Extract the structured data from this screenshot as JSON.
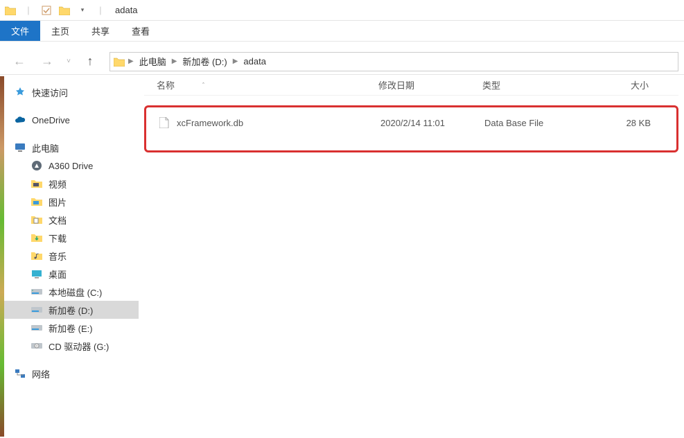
{
  "window": {
    "title": "adata"
  },
  "ribbon": {
    "file": "文件",
    "tabs": [
      "主页",
      "共享",
      "查看"
    ]
  },
  "breadcrumb": {
    "items": [
      "此电脑",
      "新加卷 (D:)",
      "adata"
    ]
  },
  "columns": {
    "name": "名称",
    "date": "修改日期",
    "type": "类型",
    "size": "大小"
  },
  "files": [
    {
      "name": "xcFramework.db",
      "date": "2020/2/14 11:01",
      "type": "Data Base File",
      "size": "28 KB"
    }
  ],
  "sidebar": {
    "quick": "快速访问",
    "onedrive": "OneDrive",
    "thispc": "此电脑",
    "pc_children": [
      {
        "label": "A360 Drive",
        "icon": "a360"
      },
      {
        "label": "视频",
        "icon": "video"
      },
      {
        "label": "图片",
        "icon": "pictures"
      },
      {
        "label": "文档",
        "icon": "documents"
      },
      {
        "label": "下载",
        "icon": "downloads"
      },
      {
        "label": "音乐",
        "icon": "music"
      },
      {
        "label": "桌面",
        "icon": "desktop"
      },
      {
        "label": "本地磁盘 (C:)",
        "icon": "drive-c"
      },
      {
        "label": "新加卷 (D:)",
        "icon": "drive"
      },
      {
        "label": "新加卷 (E:)",
        "icon": "drive"
      },
      {
        "label": "CD 驱动器 (G:)",
        "icon": "cd"
      }
    ],
    "network": "网络"
  }
}
